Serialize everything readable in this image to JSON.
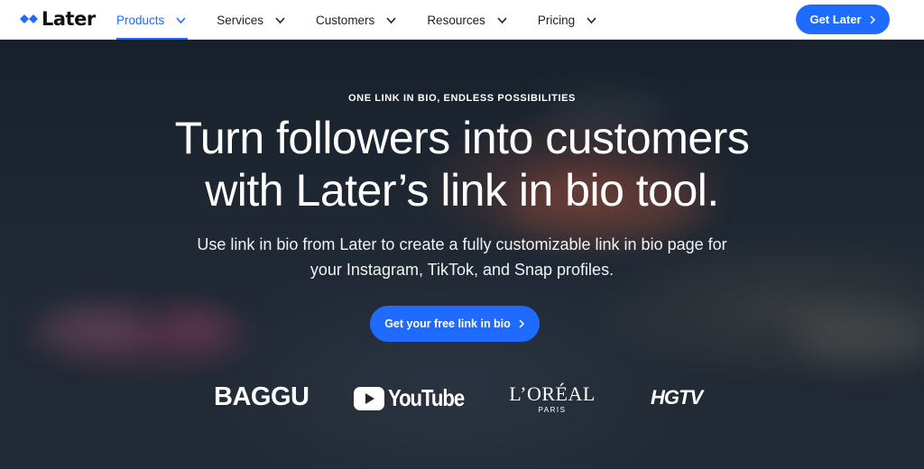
{
  "nav": {
    "logo_text": "Later",
    "items": [
      {
        "label": "Products",
        "active": true
      },
      {
        "label": "Services",
        "active": false
      },
      {
        "label": "Customers",
        "active": false
      },
      {
        "label": "Resources",
        "active": false
      },
      {
        "label": "Pricing",
        "active": false
      }
    ],
    "cta_label": "Get Later"
  },
  "hero": {
    "eyebrow": "ONE LINK IN BIO, ENDLESS POSSIBILITIES",
    "headline_line1": "Turn followers into customers",
    "headline_line2": "with Later’s link in bio tool.",
    "sub_line1": "Use link in bio from Later to create a fully customizable link in bio page for",
    "sub_line2": "your Instagram, TikTok, and Snap profiles.",
    "cta_label": "Get your free link in bio"
  },
  "brands": {
    "baggu": "BAGGU",
    "youtube": "YouTube",
    "loreal": "L’ORÉAL",
    "loreal_sub": "PARIS",
    "hgtv": "HGTV"
  },
  "colors": {
    "accent": "#1f6bff",
    "hero_bg": "#1f2833",
    "nav_bg": "#ffffff"
  },
  "icons": {
    "logo": "later-diamond-logo-icon",
    "menu_chevron": "chevron-down-icon",
    "cta_arrow": "chevron-right-icon",
    "youtube_play": "youtube-play-icon"
  }
}
